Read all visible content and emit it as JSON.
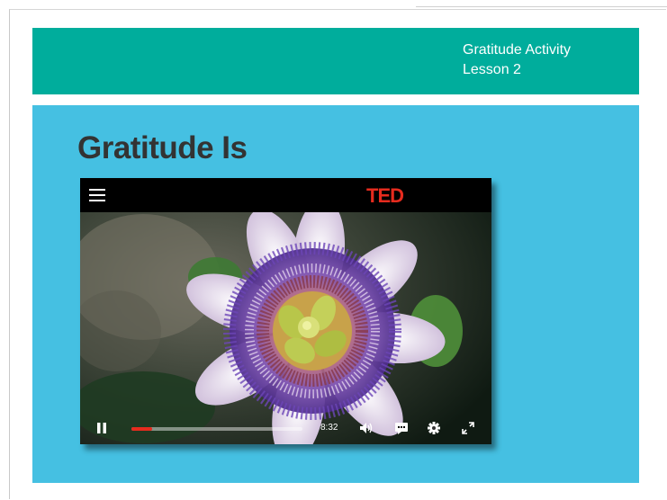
{
  "header": {
    "activity": "Gratitude Activity",
    "lesson": "Lesson 2"
  },
  "slide": {
    "title": "Gratitude Is"
  },
  "video": {
    "brand": "TED",
    "elapsed_time": "8:32",
    "progress_fraction": 0.12,
    "icons": [
      "menu-icon",
      "pause-icon",
      "volume-icon",
      "captions-icon",
      "settings-icon",
      "fullscreen-icon"
    ],
    "colors": {
      "brand_red": "#e62b1e",
      "topbar": "#000000"
    }
  },
  "colors": {
    "header_band": "#00ad9c",
    "content_band": "#45c0e2",
    "title_text": "#333333"
  }
}
